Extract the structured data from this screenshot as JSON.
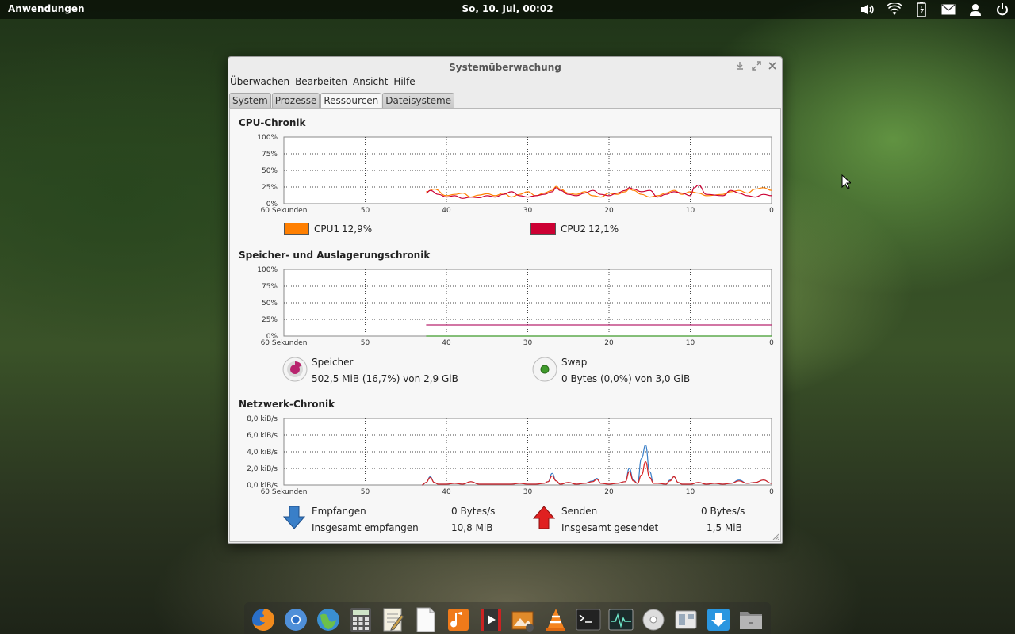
{
  "panel": {
    "apps_label": "Anwendungen",
    "clock": "So, 10. Jul, 00:02",
    "indicators": [
      "volume-icon",
      "wifi-icon",
      "battery-icon",
      "mail-icon",
      "user-icon",
      "power-icon"
    ]
  },
  "window": {
    "title": "Systemüberwachung",
    "menu": [
      "Überwachen",
      "Bearbeiten",
      "Ansicht",
      "Hilfe"
    ],
    "tabs": [
      "System",
      "Prozesse",
      "Ressourcen",
      "Dateisysteme"
    ],
    "active_tab": "Ressourcen",
    "cpu": {
      "title": "CPU-Chronik",
      "cpu1_label": "CPU1",
      "cpu1_value": "12,9%",
      "cpu1_color": "#ff7f00",
      "cpu2_label": "CPU2",
      "cpu2_value": "12,1%",
      "cpu2_color": "#cc0033"
    },
    "memory": {
      "title": "Speicher- und Auslagerungschronik",
      "mem_label": "Speicher",
      "mem_value": "502,5 MiB (16,7%) von 2,9 GiB",
      "mem_color": "#b8246e",
      "swap_label": "Swap",
      "swap_value": "0 Bytes (0,0%) von 3,0 GiB",
      "swap_color": "#3f9a2b"
    },
    "network": {
      "title": "Netzwerk-Chronik",
      "recv_label": "Empfangen",
      "recv_value": "0 Bytes/s",
      "recv_total_label": "Insgesamt empfangen",
      "recv_total_value": "10,8 MiB",
      "send_label": "Senden",
      "send_value": "0 Bytes/s",
      "send_total_label": "Insgesamt gesendet",
      "send_total_value": "1,5 MiB",
      "recv_color": "#3a7fc8",
      "send_color": "#d92020"
    }
  },
  "dock": {
    "items": [
      "firefox-icon",
      "chromium-icon",
      "midori-icon",
      "calculator-icon",
      "text-editor-icon",
      "document-icon",
      "music-icon",
      "video-icon",
      "photos-icon",
      "vlc-icon",
      "terminal-icon",
      "system-monitor-icon",
      "disc-icon",
      "switchboard-icon",
      "download-icon",
      "files-icon"
    ]
  },
  "chart_data": [
    {
      "type": "line",
      "title": "CPU-Chronik",
      "x_ticks": [
        "60 Sekunden",
        "50",
        "40",
        "30",
        "20",
        "10",
        "0"
      ],
      "y_ticks": [
        "100%",
        "75%",
        "50%",
        "25%",
        "0%"
      ],
      "xlim": [
        60,
        0
      ],
      "ylim": [
        0,
        100
      ],
      "grid": true,
      "series": [
        {
          "name": "CPU1",
          "color": "#ff7f00",
          "x": [
            42.5,
            41.5,
            40,
            39,
            38,
            37,
            36,
            35,
            34,
            33,
            32,
            31,
            30,
            29,
            28,
            27,
            26.5,
            26,
            25,
            24,
            23,
            22,
            21,
            20,
            19,
            18,
            17.5,
            17,
            16,
            15,
            14,
            13,
            12,
            11,
            10,
            9,
            8,
            6,
            5,
            4,
            3,
            2,
            1,
            0
          ],
          "y": [
            18,
            22,
            12,
            14,
            16,
            10,
            13,
            15,
            12,
            16,
            10,
            14,
            18,
            12,
            16,
            20,
            26,
            22,
            16,
            14,
            18,
            12,
            10,
            16,
            14,
            18,
            22,
            20,
            14,
            10,
            12,
            16,
            20,
            14,
            18,
            16,
            12,
            14,
            18,
            20,
            16,
            22,
            24,
            20
          ]
        },
        {
          "name": "CPU2",
          "color": "#cc0033",
          "x": [
            42.5,
            42,
            41,
            40,
            39,
            38,
            37,
            36,
            35,
            34,
            33,
            32,
            31,
            30,
            29,
            28,
            27,
            26.5,
            26,
            25,
            24,
            23,
            22,
            21,
            20,
            19,
            18,
            17.5,
            17,
            16,
            15,
            14,
            13,
            12,
            11,
            10,
            9.5,
            9,
            8,
            6,
            5,
            4,
            3,
            2,
            1,
            0
          ],
          "y": [
            16,
            20,
            14,
            10,
            12,
            8,
            10,
            9,
            12,
            10,
            14,
            18,
            12,
            10,
            12,
            14,
            18,
            24,
            20,
            14,
            12,
            16,
            20,
            14,
            12,
            16,
            20,
            24,
            22,
            18,
            20,
            10,
            14,
            18,
            16,
            12,
            24,
            28,
            14,
            12,
            20,
            16,
            12,
            10,
            14,
            12
          ]
        }
      ]
    },
    {
      "type": "line",
      "title": "Speicher- und Auslagerungschronik",
      "x_ticks": [
        "60 Sekunden",
        "50",
        "40",
        "30",
        "20",
        "10",
        "0"
      ],
      "y_ticks": [
        "100%",
        "75%",
        "50%",
        "25%",
        "0%"
      ],
      "xlim": [
        60,
        0
      ],
      "ylim": [
        0,
        100
      ],
      "grid": true,
      "series": [
        {
          "name": "Speicher",
          "color": "#b8246e",
          "x": [
            42.5,
            0
          ],
          "y": [
            16.7,
            16.7
          ]
        },
        {
          "name": "Swap",
          "color": "#3f9a2b",
          "x": [
            42.5,
            0
          ],
          "y": [
            0,
            0
          ]
        }
      ]
    },
    {
      "type": "line",
      "title": "Netzwerk-Chronik",
      "x_ticks": [
        "60 Sekunden",
        "50",
        "40",
        "30",
        "20",
        "10",
        "0"
      ],
      "y_ticks": [
        "8,0 kiB/s",
        "6,0 kiB/s",
        "4,0 kiB/s",
        "2,0 kiB/s",
        "0,0 kiB/s"
      ],
      "xlim": [
        60,
        0
      ],
      "ylim": [
        0,
        8
      ],
      "grid": true,
      "series": [
        {
          "name": "Empfangen",
          "color": "#3a7fc8",
          "x": [
            43,
            42.5,
            42,
            41.5,
            41,
            40,
            39,
            38,
            37,
            36,
            35,
            34,
            33,
            32,
            31,
            30,
            29,
            28,
            27.5,
            27,
            26.5,
            26,
            25,
            24,
            23,
            22,
            21.5,
            21,
            20,
            19,
            18,
            17.5,
            17,
            16.5,
            16,
            15.5,
            15,
            14.5,
            14,
            13,
            12.5,
            12,
            11.5,
            11,
            10,
            9,
            8,
            7,
            6,
            5,
            4,
            3,
            2,
            1,
            0
          ],
          "y": [
            0,
            0.3,
            1.0,
            0.3,
            0.1,
            0.1,
            0.2,
            0.1,
            0.4,
            0.1,
            0.1,
            0.1,
            0.1,
            0.1,
            0.2,
            0.1,
            0.1,
            0.2,
            0.4,
            1.4,
            0.5,
            0.1,
            0.3,
            0.1,
            0.2,
            0.5,
            0.8,
            0.2,
            0.1,
            0.2,
            0.4,
            2.0,
            0.6,
            0.2,
            3.2,
            4.8,
            1.6,
            0.2,
            0.2,
            0.1,
            0.6,
            1.0,
            0.3,
            0.1,
            0.1,
            0.3,
            0.1,
            0.2,
            0.1,
            0.2,
            0.6,
            0.2,
            0.3,
            0.6,
            0.2
          ]
        },
        {
          "name": "Senden",
          "color": "#d92020",
          "x": [
            43,
            42.5,
            42,
            41.5,
            41,
            40,
            39,
            38,
            37,
            36,
            35,
            34,
            33,
            32,
            31,
            30,
            29,
            28,
            27.5,
            27,
            26.5,
            26,
            25,
            24,
            23,
            22,
            21.5,
            21,
            20,
            19,
            18,
            17.5,
            17,
            16.5,
            16,
            15.5,
            15,
            14.5,
            14,
            13,
            12.5,
            12,
            11.5,
            11,
            10,
            9,
            8,
            7,
            6,
            5,
            4,
            3,
            2,
            1,
            0
          ],
          "y": [
            0,
            0.3,
            0.9,
            0.3,
            0.1,
            0.1,
            0.2,
            0.1,
            0.4,
            0.1,
            0.1,
            0.1,
            0.1,
            0.1,
            0.2,
            0.1,
            0.1,
            0.2,
            0.4,
            1.1,
            0.5,
            0.1,
            0.3,
            0.1,
            0.2,
            0.4,
            0.7,
            0.2,
            0.1,
            0.2,
            0.4,
            1.6,
            0.5,
            0.2,
            1.2,
            2.8,
            0.9,
            0.2,
            0.2,
            0.1,
            0.5,
            1.0,
            0.3,
            0.1,
            0.1,
            0.3,
            0.1,
            0.2,
            0.1,
            0.2,
            0.5,
            0.2,
            0.3,
            0.6,
            0.2
          ]
        }
      ]
    }
  ]
}
